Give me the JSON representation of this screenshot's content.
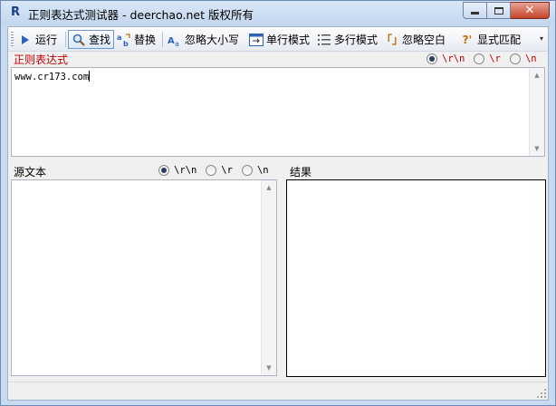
{
  "window": {
    "title": "正则表达式测试器 - deerchao.net 版权所有",
    "app_icon_glyph": "R",
    "controls": {
      "minimize": "minimize-icon",
      "maximize": "maximize-icon",
      "close": "close-icon"
    }
  },
  "toolbar": {
    "run": {
      "label": "运行",
      "icon": "play-icon"
    },
    "find": {
      "label": "查找",
      "icon": "search-icon",
      "active": true
    },
    "replace": {
      "label": "替换",
      "icon": "replace-icon"
    },
    "ignore_case": {
      "label": "忽略大小写",
      "icon": "case-icon"
    },
    "single_line": {
      "label": "单行模式",
      "icon": "single-line-icon"
    },
    "multi_line": {
      "label": "多行模式",
      "icon": "multi-line-icon"
    },
    "ignore_whitespace": {
      "label": "忽略空白",
      "icon": "whitespace-icon"
    },
    "explicit_capture": {
      "label": "显式匹配",
      "icon": "question-icon"
    }
  },
  "regex_panel": {
    "label": "正则表达式",
    "value": "www.cr173.com",
    "newline_options": [
      {
        "label": "\\r\\n",
        "checked": true
      },
      {
        "label": "\\r",
        "checked": false
      },
      {
        "label": "\\n",
        "checked": false
      }
    ]
  },
  "source_panel": {
    "label": "源文本",
    "value": "",
    "newline_options": [
      {
        "label": "\\r\\n",
        "checked": true
      },
      {
        "label": "\\r",
        "checked": false
      },
      {
        "label": "\\n",
        "checked": false
      }
    ]
  },
  "result_panel": {
    "label": "结果"
  },
  "colors": {
    "label_red": "#c00000",
    "title_bar": "#c8daf0",
    "active_button_border": "#6a9ad0"
  }
}
